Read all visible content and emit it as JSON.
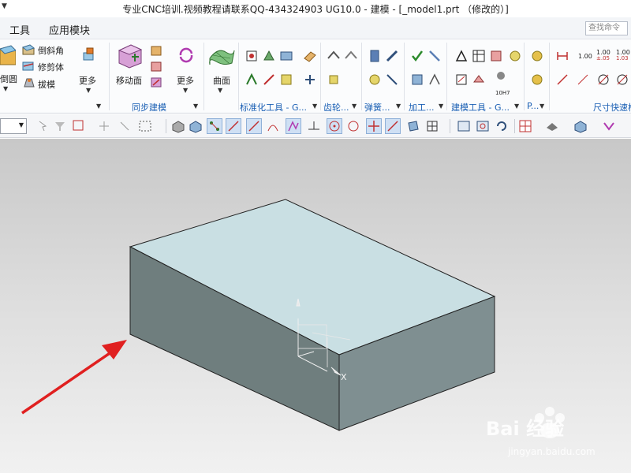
{
  "window": {
    "title": "专业CNC培训.视频教程请联系QQ-434324903 UG10.0 - 建模 - [_model1.prt （修改的）]"
  },
  "menubar": {
    "items": [
      "工具",
      "应用模块"
    ],
    "search_placeholder": "查找命令"
  },
  "ribbon": {
    "feature_items": [
      "倒圆",
      "倒斜角",
      "修剪体",
      "拔模",
      "更多"
    ],
    "sync_items": [
      "移动面",
      "更多"
    ],
    "surface_items": [
      "曲面"
    ],
    "groups": [
      "同步建模",
      "标准化工具 - G...",
      "齿轮...",
      "弹簧...",
      "加工...",
      "建模工具 - G...",
      "P...",
      "尺寸快速格"
    ],
    "dimension_labels": [
      "1.00",
      "1.00",
      "±.05",
      "1.00",
      "1.03",
      "10H7"
    ]
  },
  "viewport": {
    "axis_label": "X",
    "colors": {
      "top_face": "#c9dfe3",
      "left_face": "#6f7e7e",
      "right_face": "#7f8f91",
      "edge": "#222222",
      "arrow": "#e02020"
    }
  },
  "watermark": {
    "brand": "Bai 经验",
    "url": "jingyan.baidu.com"
  }
}
